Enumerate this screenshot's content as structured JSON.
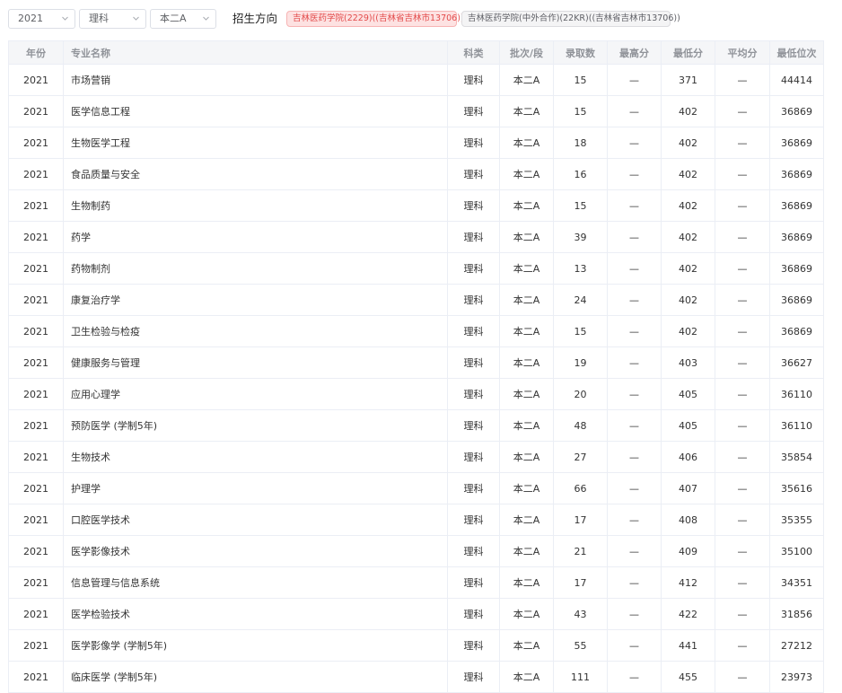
{
  "filters": {
    "year": "2021",
    "category": "理科",
    "batch": "本二A",
    "direction_label": "招生方向",
    "tags": [
      "吉林医药学院(2229)((吉林省吉林市13706))",
      "吉林医药学院(中外合作)(22KR)((吉林省吉林市13706))"
    ],
    "icon": "chevron-down-icon"
  },
  "table": {
    "headers": [
      "年份",
      "专业名称",
      "科类",
      "批次/段",
      "录取数",
      "最高分",
      "最低分",
      "平均分",
      "最低位次"
    ],
    "rows": [
      [
        "2021",
        "市场营销",
        "理科",
        "本二A",
        "15",
        "—",
        "371",
        "—",
        "44414"
      ],
      [
        "2021",
        "医学信息工程",
        "理科",
        "本二A",
        "15",
        "—",
        "402",
        "—",
        "36869"
      ],
      [
        "2021",
        "生物医学工程",
        "理科",
        "本二A",
        "18",
        "—",
        "402",
        "—",
        "36869"
      ],
      [
        "2021",
        "食品质量与安全",
        "理科",
        "本二A",
        "16",
        "—",
        "402",
        "—",
        "36869"
      ],
      [
        "2021",
        "生物制药",
        "理科",
        "本二A",
        "15",
        "—",
        "402",
        "—",
        "36869"
      ],
      [
        "2021",
        "药学",
        "理科",
        "本二A",
        "39",
        "—",
        "402",
        "—",
        "36869"
      ],
      [
        "2021",
        "药物制剂",
        "理科",
        "本二A",
        "13",
        "—",
        "402",
        "—",
        "36869"
      ],
      [
        "2021",
        "康复治疗学",
        "理科",
        "本二A",
        "24",
        "—",
        "402",
        "—",
        "36869"
      ],
      [
        "2021",
        "卫生检验与检疫",
        "理科",
        "本二A",
        "15",
        "—",
        "402",
        "—",
        "36869"
      ],
      [
        "2021",
        "健康服务与管理",
        "理科",
        "本二A",
        "19",
        "—",
        "403",
        "—",
        "36627"
      ],
      [
        "2021",
        "应用心理学",
        "理科",
        "本二A",
        "20",
        "—",
        "405",
        "—",
        "36110"
      ],
      [
        "2021",
        "预防医学 (学制5年)",
        "理科",
        "本二A",
        "48",
        "—",
        "405",
        "—",
        "36110"
      ],
      [
        "2021",
        "生物技术",
        "理科",
        "本二A",
        "27",
        "—",
        "406",
        "—",
        "35854"
      ],
      [
        "2021",
        "护理学",
        "理科",
        "本二A",
        "66",
        "—",
        "407",
        "—",
        "35616"
      ],
      [
        "2021",
        "口腔医学技术",
        "理科",
        "本二A",
        "17",
        "—",
        "408",
        "—",
        "35355"
      ],
      [
        "2021",
        "医学影像技术",
        "理科",
        "本二A",
        "21",
        "—",
        "409",
        "—",
        "35100"
      ],
      [
        "2021",
        "信息管理与信息系统",
        "理科",
        "本二A",
        "17",
        "—",
        "412",
        "—",
        "34351"
      ],
      [
        "2021",
        "医学检验技术",
        "理科",
        "本二A",
        "43",
        "—",
        "422",
        "—",
        "31856"
      ],
      [
        "2021",
        "医学影像学 (学制5年)",
        "理科",
        "本二A",
        "55",
        "—",
        "441",
        "—",
        "27212"
      ],
      [
        "2021",
        "临床医学 (学制5年)",
        "理科",
        "本二A",
        "111",
        "—",
        "455",
        "—",
        "23973"
      ]
    ]
  }
}
